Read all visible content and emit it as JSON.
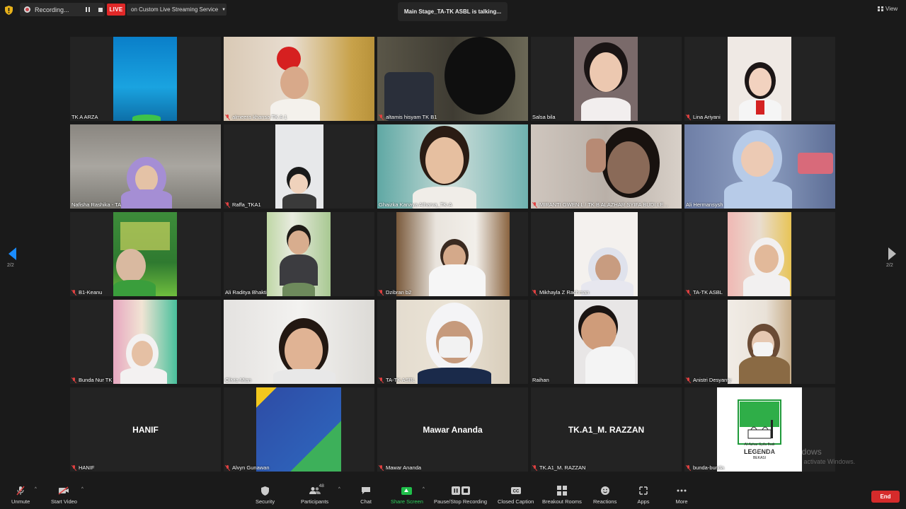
{
  "topbar": {
    "recording_label": "Recording...",
    "live_label": "LIVE",
    "stream_label": "on Custom Live Streaming Service",
    "talking_label": "Main Stage_TA-TK ASBL is talking...",
    "view_label": "View"
  },
  "gallery": {
    "tiles": [
      {
        "name": "TK A ARZA",
        "muted": false
      },
      {
        "name": "almeera khansa TK A 1",
        "muted": true
      },
      {
        "name": "altamis hisyam TK B1",
        "muted": true
      },
      {
        "name": "Salsa bila",
        "muted": false
      },
      {
        "name": "Lina Ariyani",
        "muted": true
      },
      {
        "name": "Nafisha Rashika - TA",
        "muted": false
      },
      {
        "name": "Raffa_TKA1",
        "muted": true
      },
      {
        "name": "Ghaizka Kanaya Atharva_TK-A",
        "muted": false
      },
      {
        "name": "MIRANTI GWEN L / TK B ALAZHAR SYIFA BUDI LE...",
        "muted": true
      },
      {
        "name": "Ali Hermansysh",
        "muted": false
      },
      {
        "name": "B1-Keanu",
        "muted": true
      },
      {
        "name": "Ali Raditya Bhakti",
        "muted": false
      },
      {
        "name": "Dzibran b2",
        "muted": true
      },
      {
        "name": "Mikhayla Z Rachman",
        "muted": true
      },
      {
        "name": "TA-TK ASBL",
        "muted": true
      },
      {
        "name": "Bunda Nur TK",
        "muted": true
      },
      {
        "name": "Olivia Mian",
        "muted": false
      },
      {
        "name": "TA-TK ASBL",
        "muted": true
      },
      {
        "name": "Raihan",
        "muted": false
      },
      {
        "name": "Anistri Desyanty",
        "muted": true
      },
      {
        "name": "HANIF",
        "muted": true,
        "big": "HANIF"
      },
      {
        "name": "Alvyn Gunawan",
        "muted": true
      },
      {
        "name": "Mawar Ananda",
        "muted": true,
        "big": "Mawar Ananda"
      },
      {
        "name": "TK.A1_M. RAZZAN",
        "muted": true,
        "big": "TK.A1_M. RAZZAN"
      },
      {
        "name": "bunda-bunda",
        "muted": true
      }
    ],
    "logo_text": {
      "line1": "Al-Azhar Syifa Budi",
      "line2": "LEGENDA",
      "line3": "BEKASI"
    },
    "page_left": "2/2",
    "page_right": "2/2"
  },
  "watermark": {
    "title": "Activate Windows",
    "subtitle": "Go to Settings to activate Windows."
  },
  "toolbar": {
    "unmute": "Unmute",
    "start_video": "Start Video",
    "security": "Security",
    "participants": "Participants",
    "participants_count": "48",
    "chat": "Chat",
    "share_screen": "Share Screen",
    "recording": "Pause/Stop Recording",
    "closed_caption": "Closed Caption",
    "breakout": "Breakout Rooms",
    "reactions": "Reactions",
    "apps": "Apps",
    "more": "More",
    "end": "End"
  }
}
